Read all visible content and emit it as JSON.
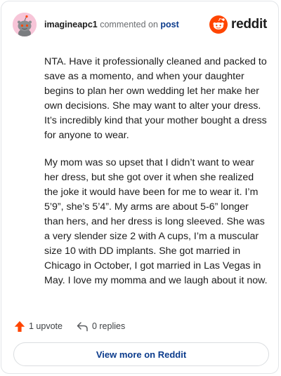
{
  "header": {
    "author": "imagineapc1",
    "action_text": "commented on",
    "post_link": "post",
    "brand": "reddit"
  },
  "comment": {
    "paragraphs": [
      "NTA. Have it professionally cleaned and packed to save as a momento, and when your daughter begins to plan her own wedding let her make her own decisions. She may want to alter your dress. It’s incredibly kind that your mother bought a dress for anyone to wear.",
      "My mom was so upset that I didn’t want to wear her dress, but she got over it when she realized the joke it would have been for me to wear it. I’m 5’9”, she’s 5’4”. My arms are about 5-6” longer than hers, and her dress is long sleeved. She was a very slender size 2 with A cups, I’m a muscular size 10 with DD implants. She got married in Chicago in October, I got married in Las Vegas in May. I love my momma and we laugh about it now."
    ]
  },
  "actions": {
    "upvote_label": "1 upvote",
    "replies_label": "0 replies"
  },
  "footer": {
    "view_more_label": "View more on Reddit"
  },
  "colors": {
    "reddit_orange": "#ff4500",
    "link_blue": "#0b3b8c",
    "avatar_bg": "#f7c5d8"
  },
  "icons": {
    "avatar": "snoo-avatar",
    "brand_logo": "reddit-logo-icon",
    "upvote": "upvote-arrow-icon",
    "reply": "reply-arrow-icon"
  }
}
